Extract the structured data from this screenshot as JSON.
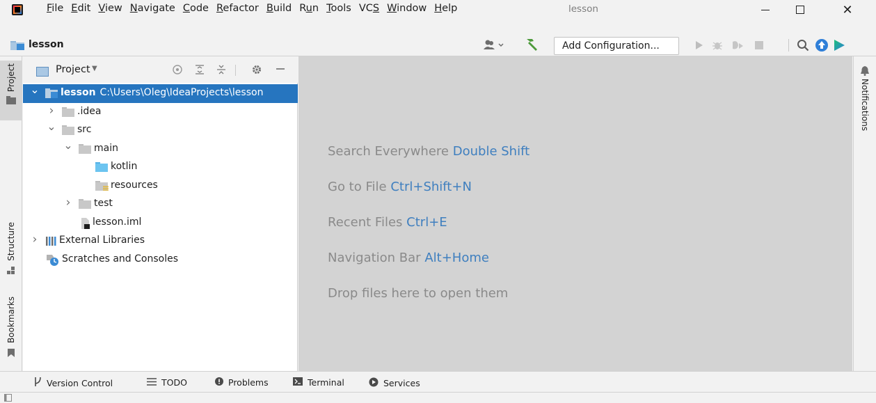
{
  "title_bar": {
    "menu": [
      {
        "mnemonic": "F",
        "rest": "ile"
      },
      {
        "mnemonic": "E",
        "rest": "dit"
      },
      {
        "mnemonic": "V",
        "rest": "iew"
      },
      {
        "mnemonic": "N",
        "rest": "avigate"
      },
      {
        "mnemonic": "C",
        "rest": "ode"
      },
      {
        "mnemonic": "R",
        "rest": "efactor"
      },
      {
        "mnemonic": "B",
        "rest": "uild"
      },
      {
        "pre": "R",
        "mnemonic": "u",
        "rest": "n"
      },
      {
        "mnemonic": "T",
        "rest": "ools"
      },
      {
        "pre": "VC",
        "mnemonic": "S",
        "rest": ""
      },
      {
        "mnemonic": "W",
        "rest": "indow"
      },
      {
        "mnemonic": "H",
        "rest": "elp"
      }
    ],
    "window_title": "lesson"
  },
  "nav_bar": {
    "project_name": "lesson",
    "run_config_label": "Add Configuration..."
  },
  "left_stripe": {
    "project_tab": "Project",
    "structure_tab": "Structure",
    "bookmarks_tab": "Bookmarks"
  },
  "right_stripe": {
    "notifications_tab": "Notifications"
  },
  "project_panel": {
    "view_selector": "Project",
    "tree": [
      {
        "name": "lesson",
        "path": "C:\\Users\\Oleg\\IdeaProjects\\lesson",
        "depth": 0,
        "expanded": true,
        "icon": "module-folder-icon",
        "selected": true
      },
      {
        "name": ".idea",
        "depth": 1,
        "expanded": false,
        "icon": "folder-icon"
      },
      {
        "name": "src",
        "depth": 1,
        "expanded": true,
        "icon": "folder-icon"
      },
      {
        "name": "main",
        "depth": 2,
        "expanded": true,
        "icon": "folder-icon"
      },
      {
        "name": "kotlin",
        "depth": 3,
        "icon": "source-folder-icon"
      },
      {
        "name": "resources",
        "depth": 3,
        "icon": "resources-folder-icon"
      },
      {
        "name": "test",
        "depth": 2,
        "expanded": false,
        "icon": "folder-icon"
      },
      {
        "name": "lesson.iml",
        "depth": 2,
        "icon": "iml-file-icon"
      },
      {
        "name": "External Libraries",
        "depth": 0,
        "expanded": false,
        "icon": "libraries-icon"
      },
      {
        "name": "Scratches and Consoles",
        "depth": 0,
        "icon": "scratches-icon"
      }
    ]
  },
  "editor_hints": [
    {
      "text": "Search Everywhere",
      "shortcut": "Double Shift"
    },
    {
      "text": "Go to File",
      "shortcut": "Ctrl+Shift+N"
    },
    {
      "text": "Recent Files",
      "shortcut": "Ctrl+E"
    },
    {
      "text": "Navigation Bar",
      "shortcut": "Alt+Home"
    },
    {
      "text": "Drop files here to open them",
      "shortcut": ""
    }
  ],
  "bottom_bar": {
    "version_control": "Version Control",
    "todo": "TODO",
    "problems": "Problems",
    "terminal": "Terminal",
    "services": "Services"
  },
  "colors": {
    "selection": "#2675bf",
    "shortcut": "#3f7fbf",
    "editor_bg": "#d3d3d3",
    "run_green": "#3d9a2d",
    "update_blue": "#2f7fd8"
  }
}
